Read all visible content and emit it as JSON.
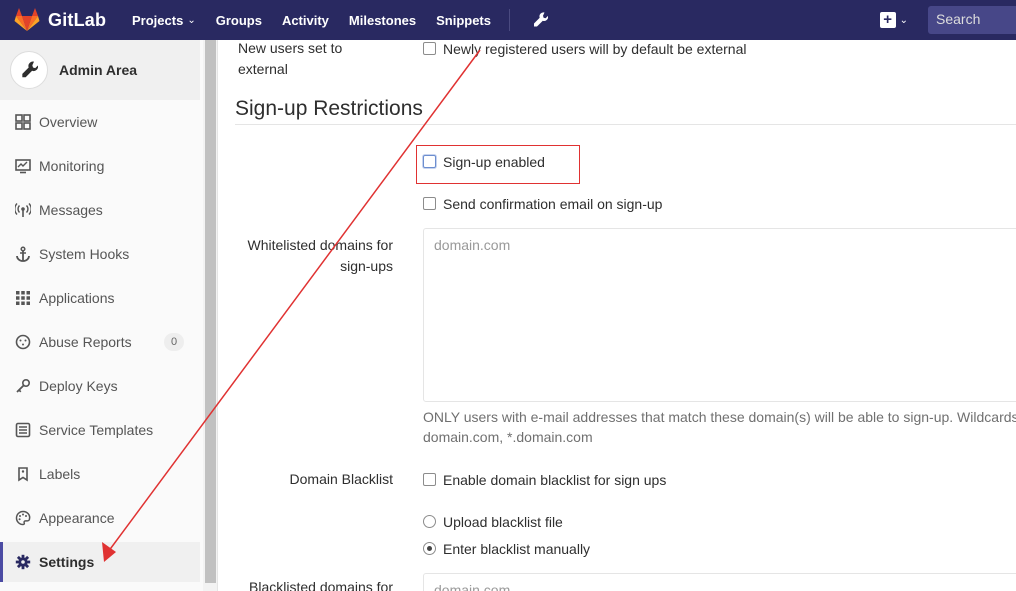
{
  "navbar": {
    "brand": "GitLab",
    "links": [
      {
        "label": "Projects",
        "has_caret": true
      },
      {
        "label": "Groups"
      },
      {
        "label": "Activity"
      },
      {
        "label": "Milestones"
      },
      {
        "label": "Snippets"
      }
    ],
    "admin_icon": "wrench-icon",
    "new_icon": "plus-square-icon",
    "search_placeholder": "Search",
    "bg_color": "#292961"
  },
  "sidebar": {
    "title": "Admin Area",
    "items": [
      {
        "label": "Overview",
        "icon": "grid-icon"
      },
      {
        "label": "Monitoring",
        "icon": "monitor-icon"
      },
      {
        "label": "Messages",
        "icon": "broadcast-icon"
      },
      {
        "label": "System Hooks",
        "icon": "anchor-icon"
      },
      {
        "label": "Applications",
        "icon": "apps-grid-icon"
      },
      {
        "label": "Abuse Reports",
        "icon": "face-icon",
        "badge": "0"
      },
      {
        "label": "Deploy Keys",
        "icon": "key-icon"
      },
      {
        "label": "Service Templates",
        "icon": "template-icon"
      },
      {
        "label": "Labels",
        "icon": "label-icon"
      },
      {
        "label": "Appearance",
        "icon": "palette-icon"
      },
      {
        "label": "Settings",
        "icon": "gear-icon",
        "active": true
      }
    ]
  },
  "form": {
    "external_label": "New users set to external",
    "external_option": "Newly registered users will by default be external",
    "section_title": "Sign-up Restrictions",
    "signup_enabled": "Sign-up enabled",
    "send_confirmation": "Send confirmation email on sign-up",
    "whitelist_label_line1": "Whitelisted domains for",
    "whitelist_label_line2": "sign-ups",
    "whitelist_placeholder": "domain.com",
    "whitelist_help_line1": "ONLY users with e-mail addresses that match these domain(s) will be able to sign-up. Wildcards",
    "whitelist_help_line2": "domain.com, *.domain.com",
    "blacklist_label": "Domain Blacklist",
    "blacklist_enable": "Enable domain blacklist for sign ups",
    "upload_blacklist": "Upload blacklist file",
    "enter_blacklist": "Enter blacklist manually",
    "blacklisted_label": "Blacklisted domains for",
    "blacklisted_placeholder": "domain.com"
  },
  "annotation": {
    "color": "#e03232"
  }
}
